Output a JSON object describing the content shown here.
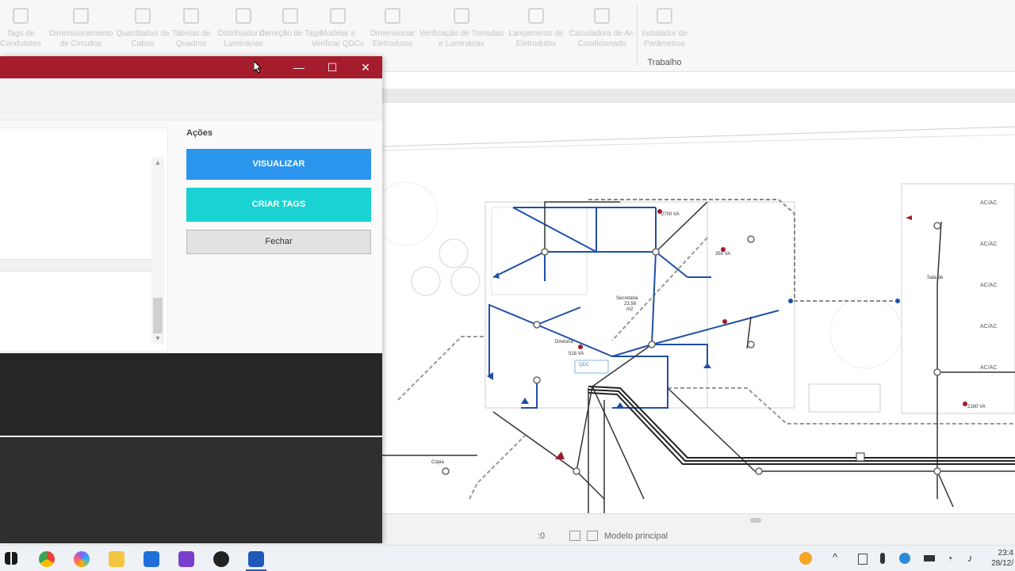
{
  "ribbon": {
    "items": [
      {
        "label": "Tags de Condutores",
        "icon": "tag-icon"
      },
      {
        "label": "Dimensionamento de Circuitos",
        "icon": "grid-icon"
      },
      {
        "label": "Quantitativo de Cabos",
        "icon": "cable-icon"
      },
      {
        "label": "Tabelas de Quadros",
        "icon": "table-icon"
      },
      {
        "label": "Distribuidor de Luminárias",
        "icon": "lamp-icon"
      },
      {
        "label": "Correção de Tags",
        "icon": "edit-icon"
      },
      {
        "label": "Modelar e Verificar QDCs",
        "icon": "panel-icon"
      },
      {
        "label": "Dimensionar Eletrodutos",
        "icon": "conduit-icon"
      },
      {
        "label": "Verificação de Tomadas e Luminárias",
        "icon": "check-icon"
      },
      {
        "label": "Lançamento de Eletrodutos",
        "icon": "route-icon"
      },
      {
        "label": "Calculadora de Ar-Condicionado",
        "icon": "calculator-icon"
      },
      {
        "label": "Instalador de Parâmetros",
        "icon": "parameters-icon"
      }
    ],
    "group_label": "Trabalho"
  },
  "dialog": {
    "section_title": "Ações",
    "btn_visualizar": "VISUALIZAR",
    "btn_criar_tags": "CRIAR TAGS",
    "btn_fechar": "Fechar",
    "minimize": "—",
    "maximize": "☐",
    "close": "✕"
  },
  "cad": {
    "room_labels": [
      "Secretaria\n23,58\nm2",
      "Diretoria",
      "QDC\nSECRETARIA",
      "Sala de\nEstar\nm2",
      "Cópia\nm2"
    ],
    "load_labels": [
      "2700 VA",
      "350 VA",
      "518 VA",
      "2180 VA"
    ],
    "ac_label": "AC/AC"
  },
  "statusbar": {
    "scale": ":0",
    "model": "Modelo principal"
  },
  "taskbar": {
    "time": "23:4",
    "date": "28/12/"
  },
  "colors": {
    "titlebar": "#a51d2d",
    "btn_visualizar": "#2b95ee",
    "btn_criar_tags": "#1bd2d2",
    "circuit_blue": "#1f4fa8"
  }
}
